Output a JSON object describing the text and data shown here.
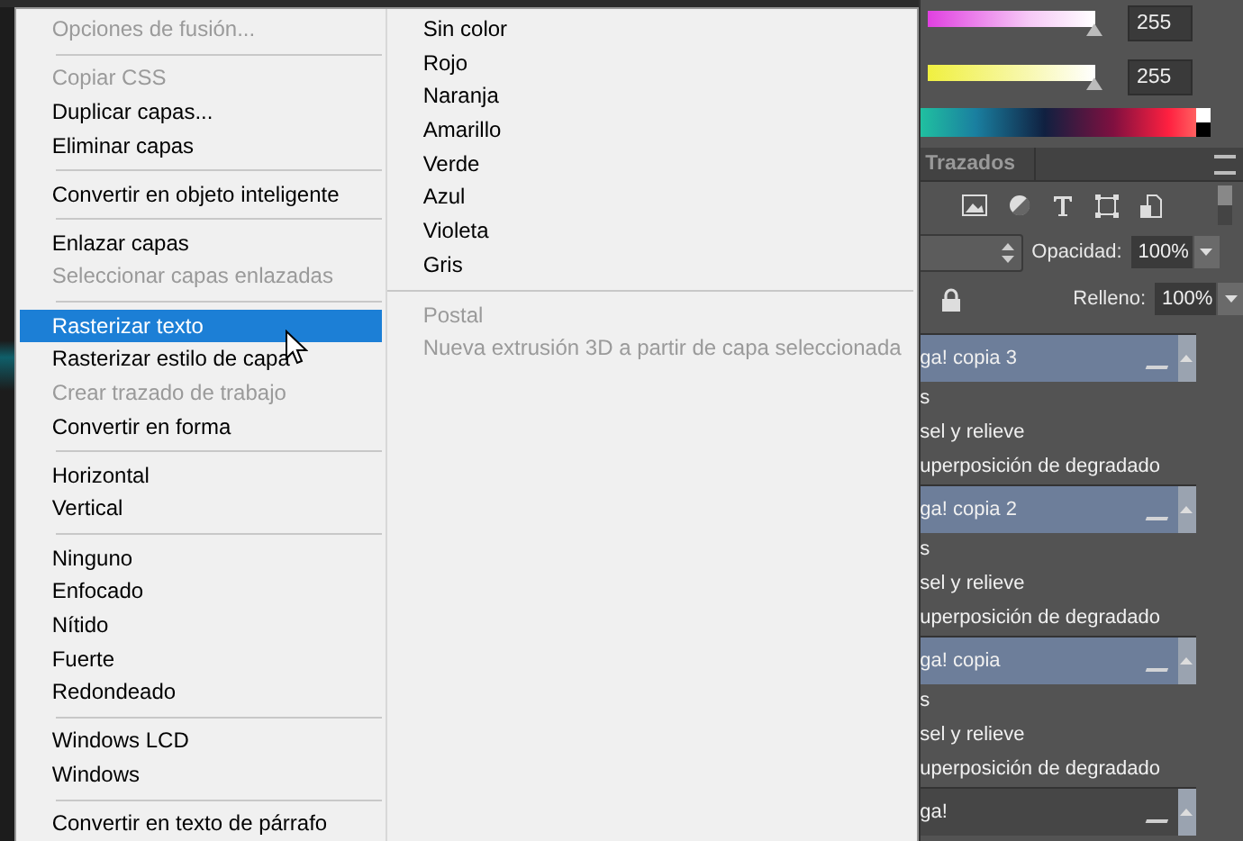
{
  "context_menu": {
    "left_groups": [
      [
        {
          "label": "Opciones de fusión...",
          "disabled": true,
          "selected": false
        }
      ],
      [
        {
          "label": "Copiar CSS",
          "disabled": true,
          "selected": false
        },
        {
          "label": "Duplicar capas...",
          "disabled": false,
          "selected": false
        },
        {
          "label": "Eliminar capas",
          "disabled": false,
          "selected": false
        }
      ],
      [
        {
          "label": "Convertir en objeto inteligente",
          "disabled": false,
          "selected": false
        }
      ],
      [
        {
          "label": "Enlazar capas",
          "disabled": false,
          "selected": false
        },
        {
          "label": "Seleccionar capas enlazadas",
          "disabled": true,
          "selected": false
        }
      ],
      [
        {
          "label": "Rasterizar texto",
          "disabled": false,
          "selected": true
        },
        {
          "label": "Rasterizar estilo de capa",
          "disabled": false,
          "selected": false
        },
        {
          "label": "Crear trazado de trabajo",
          "disabled": true,
          "selected": false
        },
        {
          "label": "Convertir en forma",
          "disabled": false,
          "selected": false
        }
      ],
      [
        {
          "label": "Horizontal",
          "disabled": false,
          "selected": false
        },
        {
          "label": "Vertical",
          "disabled": false,
          "selected": false
        }
      ],
      [
        {
          "label": "Ninguno",
          "disabled": false,
          "selected": false
        },
        {
          "label": "Enfocado",
          "disabled": false,
          "selected": false
        },
        {
          "label": "Nítido",
          "disabled": false,
          "selected": false
        },
        {
          "label": "Fuerte",
          "disabled": false,
          "selected": false
        },
        {
          "label": "Redondeado",
          "disabled": false,
          "selected": false
        }
      ],
      [
        {
          "label": "Windows LCD",
          "disabled": false,
          "selected": false
        },
        {
          "label": "Windows",
          "disabled": false,
          "selected": false
        }
      ],
      [
        {
          "label": "Convertir en texto de párrafo",
          "disabled": false,
          "selected": false
        }
      ]
    ],
    "right_groups": [
      [
        {
          "label": "Sin color",
          "disabled": false,
          "selected": false
        },
        {
          "label": "Rojo",
          "disabled": false,
          "selected": false
        },
        {
          "label": "Naranja",
          "disabled": false,
          "selected": false
        },
        {
          "label": "Amarillo",
          "disabled": false,
          "selected": false
        },
        {
          "label": "Verde",
          "disabled": false,
          "selected": false
        },
        {
          "label": "Azul",
          "disabled": false,
          "selected": false
        },
        {
          "label": "Violeta",
          "disabled": false,
          "selected": false
        },
        {
          "label": "Gris",
          "disabled": false,
          "selected": false
        }
      ],
      [
        {
          "label": "Postal",
          "disabled": true,
          "selected": false
        },
        {
          "label": "Nueva extrusión 3D a partir de capa seleccionada",
          "disabled": true,
          "selected": false
        }
      ]
    ]
  },
  "color_panel": {
    "sliders": [
      {
        "value": "255",
        "level": 1,
        "kind": "magenta"
      },
      {
        "value": "255",
        "level": 1,
        "kind": "yellow"
      }
    ]
  },
  "layers_panel": {
    "tab": "Trazados",
    "opacity": {
      "label": "Opacidad:",
      "value": "100%"
    },
    "fill": {
      "label": "Relleno:",
      "value": "100%"
    },
    "layers": [
      {
        "name": "ga! copia 3",
        "selected": true,
        "effects": [
          "s",
          "sel y relieve",
          "uperposición de degradado"
        ]
      },
      {
        "name": "ga! copia 2",
        "selected": true,
        "effects": [
          "s",
          "sel y relieve",
          "uperposición de degradado"
        ]
      },
      {
        "name": "ga! copia",
        "selected": true,
        "effects": [
          "s",
          "sel y relieve",
          "uperposición de degradado"
        ]
      },
      {
        "name": "ga!",
        "selected": false
      }
    ]
  }
}
